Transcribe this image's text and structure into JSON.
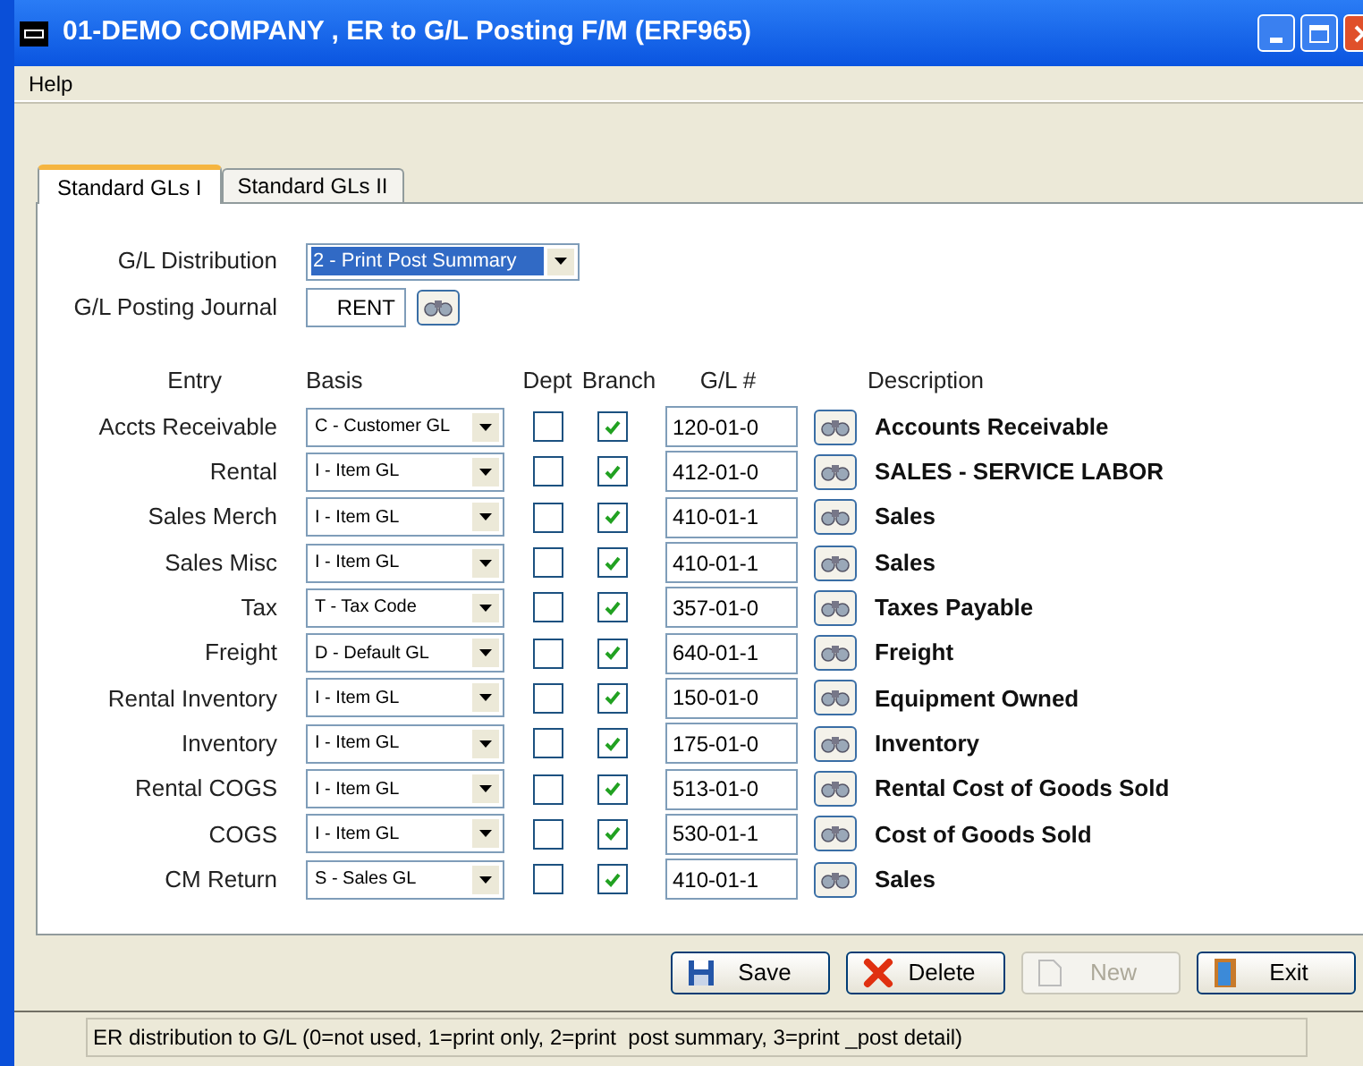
{
  "window": {
    "title": "01-DEMO COMPANY , ER to G/L Posting F/M (ERF965)"
  },
  "menu": [
    "Help"
  ],
  "tabs": [
    {
      "label": "Standard GLs I",
      "selected": true
    },
    {
      "label": "Standard GLs II",
      "selected": false
    }
  ],
  "gl_distribution": {
    "label": "G/L Distribution",
    "value": "2 - Print Post Summary"
  },
  "gl_posting_journal": {
    "label": "G/L Posting Journal",
    "value": "RENT"
  },
  "columns": [
    "Entry",
    "Basis",
    "Dept",
    "Branch",
    "G/L #",
    "Description"
  ],
  "rows": [
    {
      "entry": "Accts Receivable",
      "basis": "C - Customer GL",
      "dept": false,
      "branch": true,
      "gl": "120-01-0",
      "description": "Accounts Receivable"
    },
    {
      "entry": "Rental",
      "basis": "I - Item GL",
      "dept": false,
      "branch": true,
      "gl": "412-01-0",
      "description": "SALES - SERVICE LABOR"
    },
    {
      "entry": "Sales Merch",
      "basis": "I - Item GL",
      "dept": false,
      "branch": true,
      "gl": "410-01-1",
      "description": "Sales"
    },
    {
      "entry": "Sales Misc",
      "basis": "I - Item GL",
      "dept": false,
      "branch": true,
      "gl": "410-01-1",
      "description": "Sales"
    },
    {
      "entry": "Tax",
      "basis": "T - Tax Code",
      "dept": false,
      "branch": true,
      "gl": "357-01-0",
      "description": "Taxes Payable"
    },
    {
      "entry": "Freight",
      "basis": "D - Default GL",
      "dept": false,
      "branch": true,
      "gl": "640-01-1",
      "description": "Freight"
    },
    {
      "entry": "Rental Inventory",
      "basis": "I - Item GL",
      "dept": false,
      "branch": true,
      "gl": "150-01-0",
      "description": "Equipment Owned"
    },
    {
      "entry": "Inventory",
      "basis": "I - Item GL",
      "dept": false,
      "branch": true,
      "gl": "175-01-0",
      "description": "Inventory"
    },
    {
      "entry": "Rental COGS",
      "basis": "I - Item GL",
      "dept": false,
      "branch": true,
      "gl": "513-01-0",
      "description": "Rental Cost of Goods Sold"
    },
    {
      "entry": "COGS",
      "basis": "I - Item GL",
      "dept": false,
      "branch": true,
      "gl": "530-01-1",
      "description": "Cost of Goods Sold"
    },
    {
      "entry": "CM Return",
      "basis": "S - Sales GL",
      "dept": false,
      "branch": true,
      "gl": "410-01-1",
      "description": "Sales"
    }
  ],
  "buttons": [
    {
      "kind": "save",
      "label": "Save",
      "disabled": false
    },
    {
      "kind": "delete",
      "label": "Delete",
      "disabled": false
    },
    {
      "kind": "new",
      "label": "New",
      "disabled": true
    },
    {
      "kind": "exit",
      "label": "Exit",
      "disabled": false
    }
  ],
  "status_bar": "ER distribution to G/L (0=not used, 1=print only, 2=print  post summary, 3=print _post detail)"
}
